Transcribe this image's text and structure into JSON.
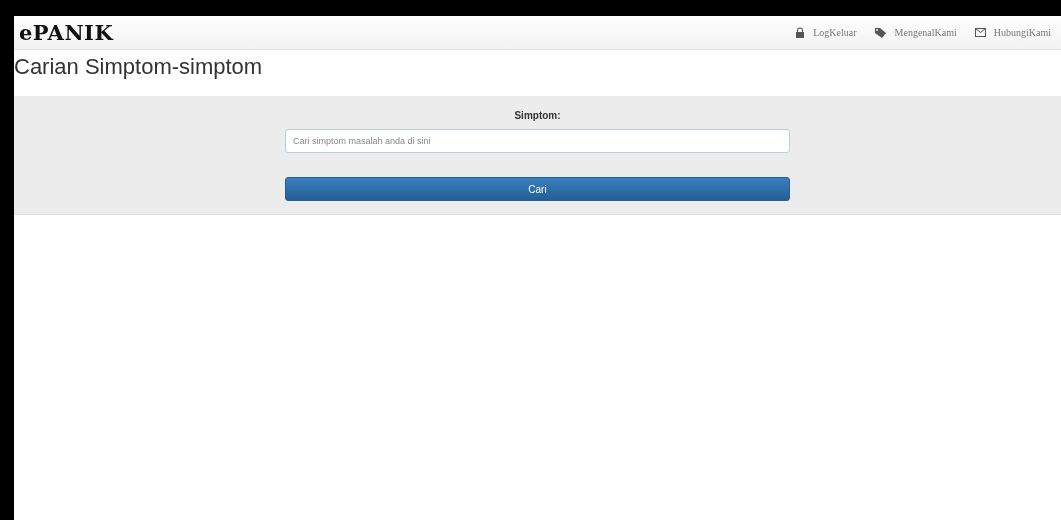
{
  "navbar": {
    "brand": "ePANIK",
    "links": [
      {
        "label": "LogKeluar",
        "kind": "logout"
      },
      {
        "label": "MengenalKami",
        "kind": "about"
      },
      {
        "label": "HubungiKami",
        "kind": "contact"
      }
    ]
  },
  "page_title": "Carian Simptom-simptom",
  "search": {
    "label": "Simptom:",
    "placeholder": "Cari simptom masalah anda di sini",
    "button": "Cari"
  }
}
